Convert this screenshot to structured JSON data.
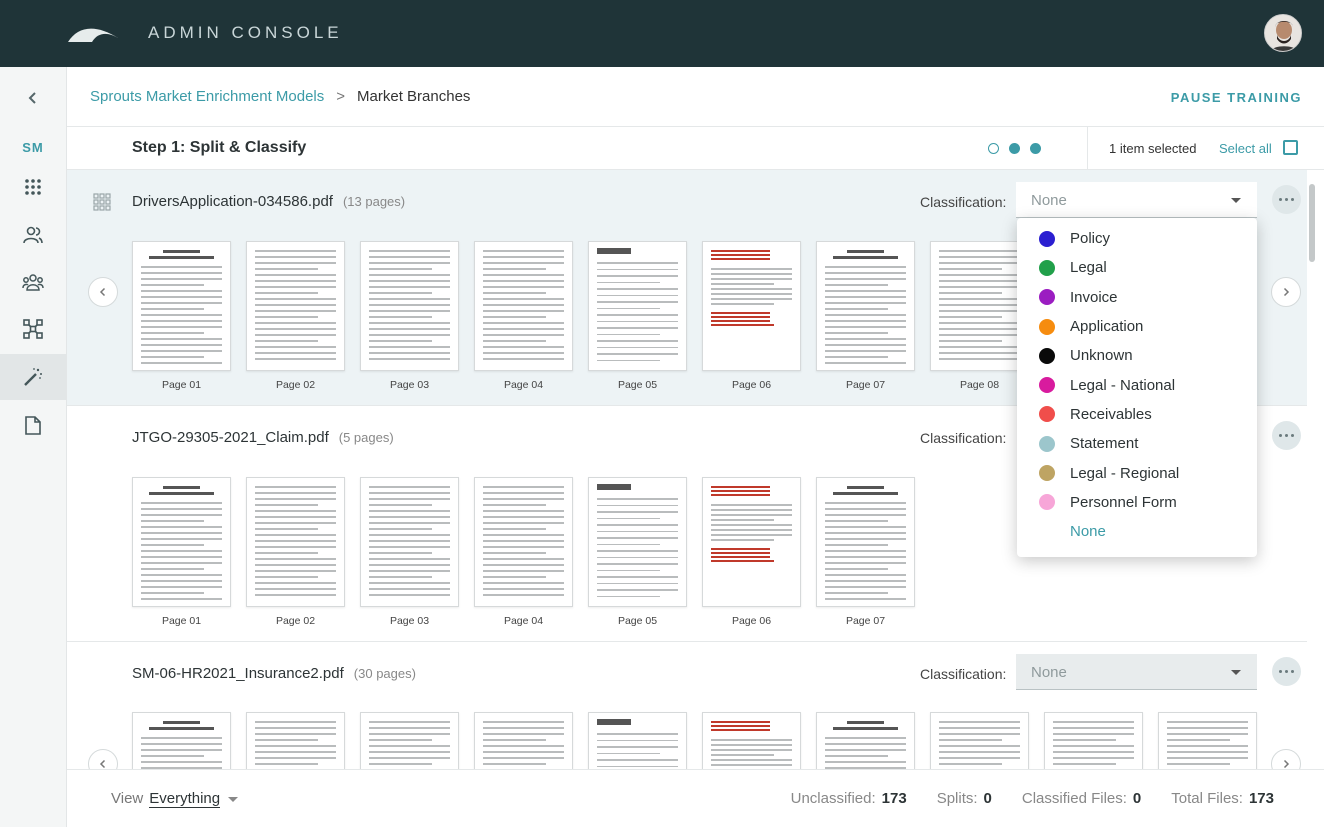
{
  "header": {
    "brand": "ADMIN CONSOLE"
  },
  "sidebar": {
    "initials": "SM",
    "items": [
      "back-icon",
      "apps-grid-icon",
      "users-icon",
      "teams-icon",
      "workflow-icon",
      "magic-wand-icon",
      "document-icon"
    ]
  },
  "breadcrumb": {
    "parent": "Sprouts Market Enrichment Models",
    "separator": ">",
    "current": "Market Branches"
  },
  "actions": {
    "pause": "PAUSE TRAINING"
  },
  "step": {
    "title": "Step 1: Split & Classify",
    "selected_count": "1 item selected",
    "select_all": "Select all"
  },
  "documents": [
    {
      "name": "DriversApplication-034586.pdf",
      "pages_text": "(13 pages)",
      "classification_label": "Classification:",
      "classification_value": "None",
      "page_labels": [
        "Page 01",
        "Page 02",
        "Page 03",
        "Page 04",
        "Page 05",
        "Page 06",
        "Page 07",
        "Page 08"
      ]
    },
    {
      "name": "JTGO-29305-2021_Claim.pdf",
      "pages_text": "(5 pages)",
      "classification_label": "Classification:",
      "classification_value": "",
      "page_labels": [
        "Page 01",
        "Page 02",
        "Page 03",
        "Page 04",
        "Page 05",
        "Page 06",
        "Page 07"
      ]
    },
    {
      "name": "SM-06-HR2021_Insurance2.pdf",
      "pages_text": "(30 pages)",
      "classification_label": "Classification:",
      "classification_value": "None",
      "page_labels": []
    }
  ],
  "dropdown": {
    "options": [
      {
        "label": "Policy",
        "color": "#2b1fd1"
      },
      {
        "label": "Legal",
        "color": "#21a04a"
      },
      {
        "label": "Invoice",
        "color": "#9b1dc1"
      },
      {
        "label": "Application",
        "color": "#f68c0f"
      },
      {
        "label": "Unknown",
        "color": "#0a0a0a"
      },
      {
        "label": "Legal - National",
        "color": "#d81b9e"
      },
      {
        "label": "Receivables",
        "color": "#f04e4b"
      },
      {
        "label": "Statement",
        "color": "#9cc6cc"
      },
      {
        "label": "Legal - Regional",
        "color": "#bea463"
      },
      {
        "label": "Personnel Form",
        "color": "#f7a6d8"
      }
    ],
    "none_label": "None"
  },
  "footer": {
    "view_label": "View",
    "view_value": "Everything",
    "stats": [
      {
        "label": "Unclassified:",
        "value": "173"
      },
      {
        "label": "Splits:",
        "value": "0"
      },
      {
        "label": "Classified Files:",
        "value": "0"
      },
      {
        "label": "Total Files:",
        "value": "173"
      }
    ]
  }
}
